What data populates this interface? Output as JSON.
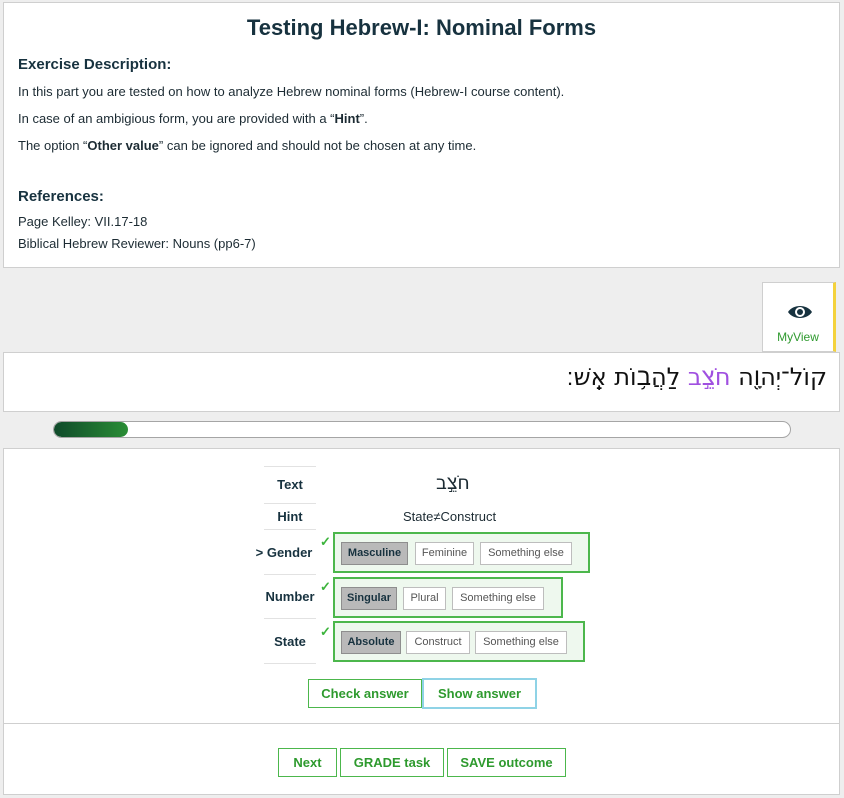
{
  "exercise": {
    "title": "Testing Hebrew-I: Nominal Forms",
    "description_heading": "Exercise Description:",
    "line1": "In this part you are tested on how to analyze Hebrew nominal forms (Hebrew-I course content).",
    "line2_pre": "In case of an ambigious form, you are provided with a “",
    "line2_bold": "Hint",
    "line2_post": "”.",
    "line3_pre": "The option “",
    "line3_bold": "Other value",
    "line3_post": "” can be ignored and should not be chosen at any time.",
    "references_heading": "References:",
    "ref1": "Page Kelley: VII.17-18",
    "ref2": "Biblical Hebrew Reviewer: Nouns (pp6-7)"
  },
  "myview": {
    "label": "MyView",
    "icon": "eye-icon"
  },
  "verse": {
    "before": "קוֹל־יְהוָ֖ה ",
    "highlight": "חֹצֵ֣ב",
    "after": " לַהֲב֥וֹת אֵֽשׁ׃"
  },
  "progress": {
    "fraction": 0.1
  },
  "question": {
    "text_label": "Text",
    "text_value": "חֹצֵ֣ב",
    "hint_label": "Hint",
    "hint_value": "State≠Construct",
    "gender": {
      "label": "> Gender",
      "check": "✓",
      "options": [
        "Masculine",
        "Feminine",
        "Something else"
      ],
      "selected": "Masculine"
    },
    "number": {
      "label": "Number",
      "check": "✓",
      "options": [
        "Singular",
        "Plural",
        "Something else"
      ],
      "selected": "Singular"
    },
    "state": {
      "label": "State",
      "check": "✓",
      "options": [
        "Absolute",
        "Construct",
        "Something else"
      ],
      "selected": "Absolute"
    }
  },
  "actions": {
    "check_answer": "Check answer",
    "show_answer": "Show answer",
    "next": "Next",
    "grade": "GRADE task",
    "save": "SAVE outcome"
  },
  "colors": {
    "accent_green": "#4cb74c",
    "highlight_purple": "#a050e0",
    "progress_dark": "#0f4a2a"
  }
}
